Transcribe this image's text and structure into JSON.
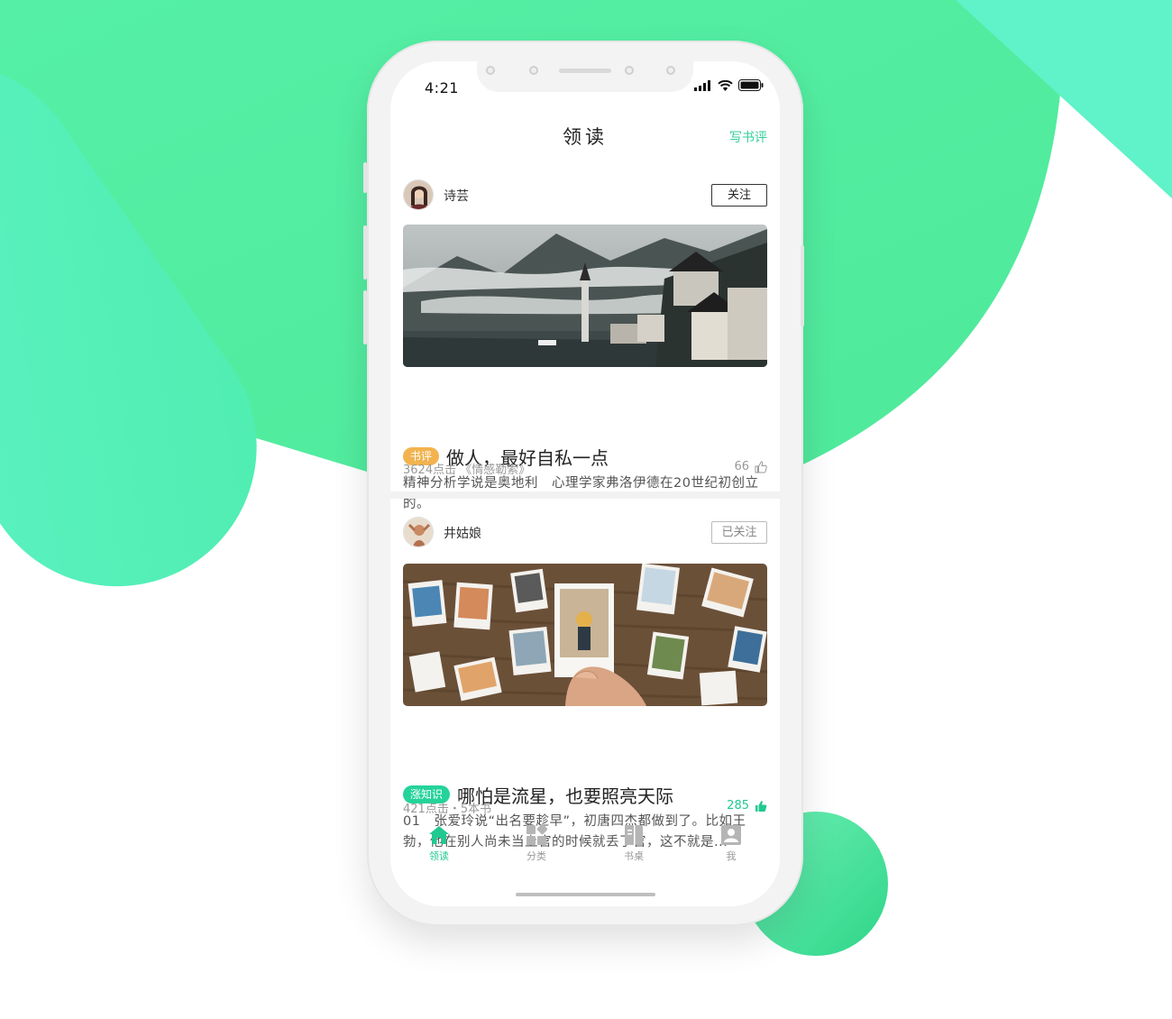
{
  "colors": {
    "accent": "#20c98f",
    "background_green_light": "#5cf2bf",
    "background_green": "#52ef9c",
    "tag_orange": "#f2b34f"
  },
  "status_bar": {
    "time": "4:21",
    "icons": [
      "signal-icon",
      "wifi-icon",
      "battery-icon"
    ]
  },
  "nav": {
    "title": "领读",
    "action": "写书评"
  },
  "posts": [
    {
      "user": "诗芸",
      "follow": "关注",
      "followed": false,
      "tag": "书评",
      "tag_color": "orange",
      "title": "做人，最好自私一点",
      "excerpt": "精神分析学说是奥地利　心理学家弗洛伊德在20世纪初创立的。",
      "meta": "3624点击 《情感勒索》",
      "likes": "66",
      "liked": false,
      "cover": "misty-lakeside-village-photo"
    },
    {
      "user": "井姑娘",
      "follow": "已关注",
      "followed": true,
      "tag": "涨知识",
      "tag_color": "green",
      "title": "哪怕是流星，也要照亮天际",
      "excerpt": "01　张爱玲说“出名要趁早”，初唐四杰都做到了。比如王勃，他在别人尚未当上官的时候就丢了官，这不就是...",
      "meta": "421点击・5本书",
      "likes": "285",
      "liked": true,
      "cover": "polaroid-photos-on-table-photo"
    }
  ],
  "tabbar": [
    {
      "label": "领读",
      "icon": "home-icon",
      "active": true
    },
    {
      "label": "分类",
      "icon": "category-icon",
      "active": false
    },
    {
      "label": "书桌",
      "icon": "book-icon",
      "active": false
    },
    {
      "label": "我",
      "icon": "profile-icon",
      "active": false
    }
  ]
}
